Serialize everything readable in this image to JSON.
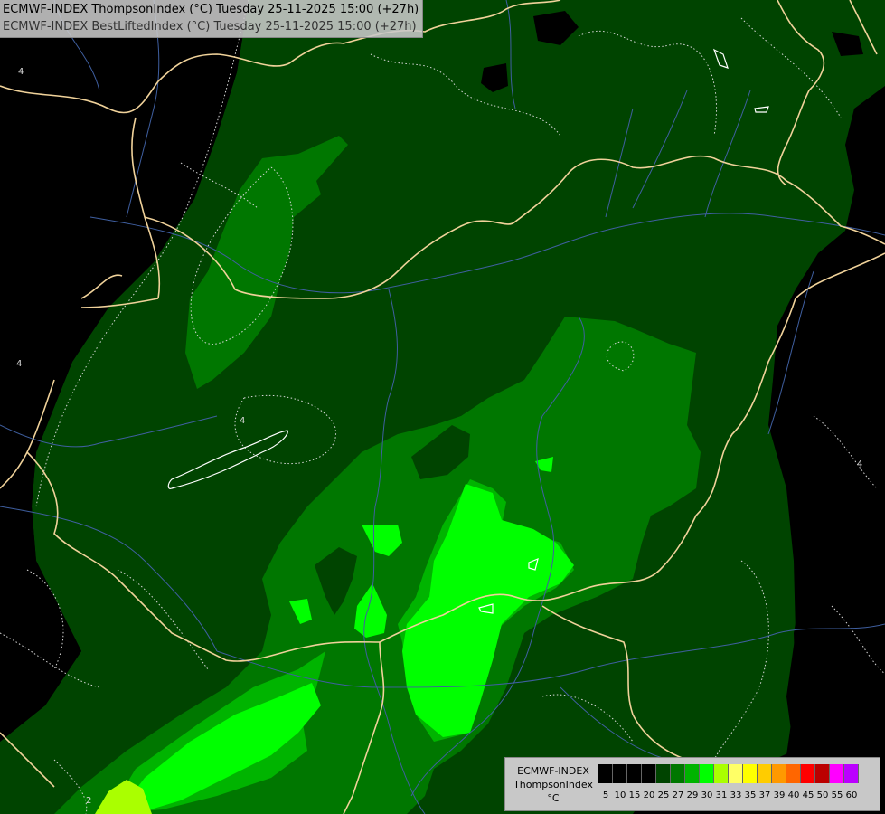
{
  "header": {
    "line1": "ECMWF-INDEX ThompsonIndex (°C) Tuesday 25-11-2025 15:00 (+27h)",
    "line2": "ECMWF-INDEX BestLiftedIndex (°C) Tuesday 25-11-2025 15:00 (+27h)"
  },
  "contour_labels": [
    "4",
    "4",
    "4",
    "4",
    "2"
  ],
  "legend": {
    "line1": "ECMWF-INDEX",
    "line2": "ThompsonIndex",
    "unit": "°C",
    "ticks": [
      "5",
      "10",
      "15",
      "20",
      "25",
      "27",
      "29",
      "30",
      "31",
      "33",
      "35",
      "37",
      "39",
      "40",
      "45",
      "50",
      "55",
      "60"
    ],
    "colors": [
      "#000000",
      "#000000",
      "#000000",
      "#000000",
      "#004400",
      "#007700",
      "#00b400",
      "#00ff00",
      "#aaff00",
      "#ffff66",
      "#ffff00",
      "#ffcc00",
      "#ff9900",
      "#ff6600",
      "#ff0000",
      "#bb0000",
      "#ff00ff",
      "#bb00ff",
      "#8800ff",
      "#6600ff",
      "#0000ff"
    ]
  },
  "colors": {
    "level_20_25": "#004400",
    "level_25_27": "#007700",
    "level_27_29": "#00b400",
    "level_29_30": "#00ff00",
    "level_30_31": "#aaff00",
    "borders": "#f0d29a",
    "rivers": "#3f5fa0",
    "contours": "#d8d8d8"
  }
}
